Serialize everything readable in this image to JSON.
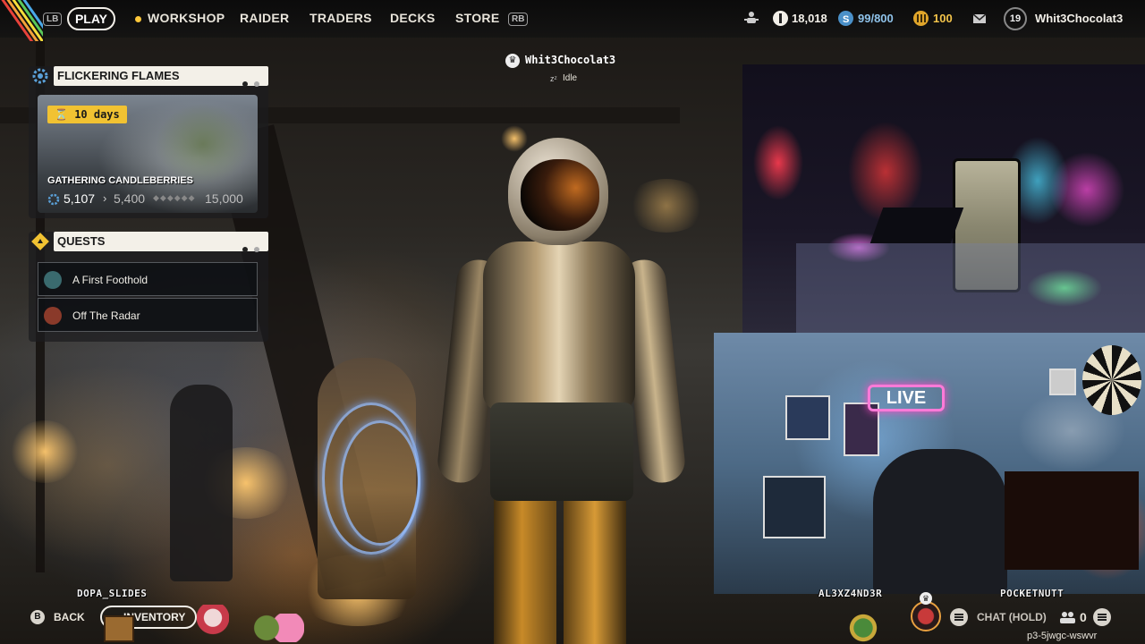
{
  "topbar": {
    "lb_hint": "LB",
    "rb_hint": "RB",
    "tabs": [
      "PLAY",
      "WORKSHOP",
      "RAIDER",
      "TRADERS",
      "DECKS",
      "STORE"
    ],
    "currency_coins": "18,018",
    "currency_tokens": "99/800",
    "currency_credits": "100",
    "player_level": "19",
    "player_name": "Whit3Chocolat3"
  },
  "event_panel": {
    "title": "FLICKERING FLAMES",
    "timer": "10 days",
    "objective": "GATHERING CANDLEBERRIES",
    "current": "5,107",
    "next": "5,400",
    "goal": "15,000"
  },
  "quests_panel": {
    "title": "QUESTS",
    "items": [
      {
        "label": "A First Foothold",
        "color": "#3a6a6e"
      },
      {
        "label": "Off The Radar",
        "color": "#8a3a2a"
      }
    ]
  },
  "player_tag": {
    "name": "Whit3Chocolat3",
    "status": "Idle"
  },
  "bottom": {
    "back_button_hint": "B",
    "back_label": "BACK",
    "inventory_label": "INVENTORY",
    "chat_label": "CHAT (HOLD)",
    "party_count": "0",
    "session_code": "p3-5jwgc-wswvr"
  },
  "overlay": {
    "streamers": [
      "DOPA_SLIDES",
      "AL3XZ4ND3R",
      "POCKETNUTT"
    ],
    "live_sign": "LIVE"
  },
  "colors": {
    "accent_yellow": "#f1c232",
    "panel_header_bg": "#f3f0e8",
    "credits_gold": "#e0a52a",
    "tokens_blue": "#4a90c8"
  }
}
